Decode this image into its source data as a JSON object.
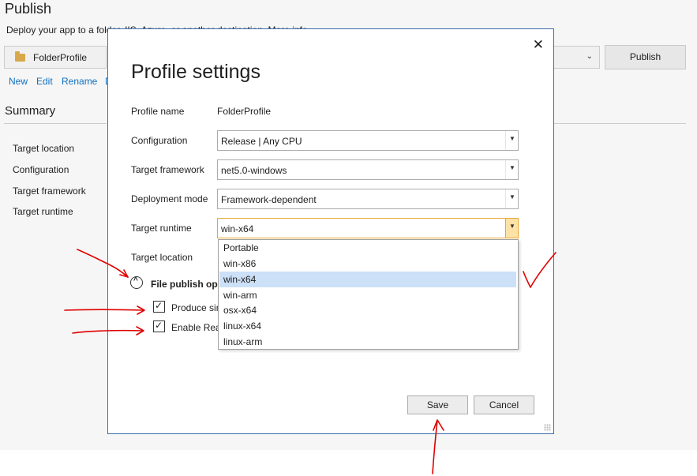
{
  "publish_page": {
    "title": "Publish",
    "description": "Deploy your app to a folder, IIS, Azure, or another destination. More info",
    "profile_name": "FolderProfile",
    "publish_button": "Publish",
    "links": [
      "New",
      "Edit",
      "Rename",
      "D"
    ],
    "summary_title": "Summary",
    "summary_items": [
      "Target location",
      "Configuration",
      "Target framework",
      "Target runtime"
    ]
  },
  "dialog": {
    "title": "Profile settings",
    "close_label": "✕",
    "profile_name_label": "Profile name",
    "profile_name_value": "FolderProfile",
    "configuration_label": "Configuration",
    "configuration_value": "Release | Any CPU",
    "framework_label": "Target framework",
    "framework_value": "net5.0-windows",
    "deployment_label": "Deployment mode",
    "deployment_value": "Framework-dependent",
    "runtime_label": "Target runtime",
    "runtime_value": "win-x64",
    "location_label": "Target location",
    "runtime_options": [
      "Portable",
      "win-x86",
      "win-x64",
      "win-arm",
      "osx-x64",
      "linux-x64",
      "linux-arm"
    ],
    "runtime_selected": "win-x64",
    "file_publish_section": "File publish op",
    "checkbox_single_file": "Produce sin",
    "checkbox_ready_to_run": "Enable Rea",
    "save_button": "Save",
    "cancel_button": "Cancel"
  },
  "icons": {
    "folder": "folder-icon",
    "close": "close-icon",
    "expander": "chevron-up-icon",
    "dropdown": "chevron-down-icon"
  },
  "colors": {
    "accent_link": "#0e70c0",
    "dialog_border": "#3d6ea8",
    "focus_border": "#e8a736",
    "selected_item": "#cce0f7",
    "annotation": "#e00000"
  }
}
